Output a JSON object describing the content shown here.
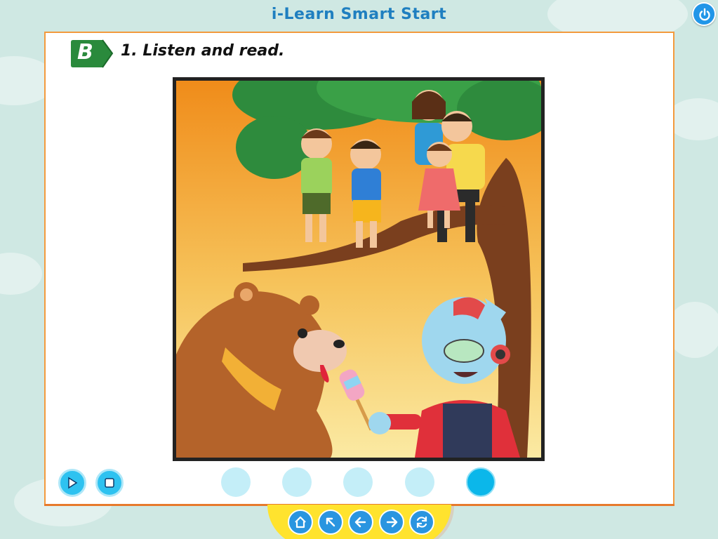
{
  "app": {
    "title": "i-Learn Smart Start"
  },
  "exercise": {
    "section_label": "B",
    "title": "1. Listen and read."
  },
  "colors": {
    "background": "#cfe8e3",
    "panel_border": "#f39a3d",
    "badge": "#2a8a3c",
    "title": "#1f7fc0",
    "control_buttons": "#2ec2f0",
    "nav_tray": "#ffe32e",
    "nav_buttons": "#2a95e0"
  },
  "controls": {
    "play": {
      "icon": "play-icon"
    },
    "stop": {
      "icon": "stop-icon"
    }
  },
  "pages": {
    "total": 5,
    "current": 5
  },
  "nav": {
    "items": [
      {
        "icon": "home-icon"
      },
      {
        "icon": "arrow-up-left-icon"
      },
      {
        "icon": "arrow-left-icon"
      },
      {
        "icon": "arrow-right-icon"
      },
      {
        "icon": "refresh-icon"
      }
    ]
  },
  "illustration": {
    "subject": "bear-and-robot-under-tree-with-family"
  }
}
